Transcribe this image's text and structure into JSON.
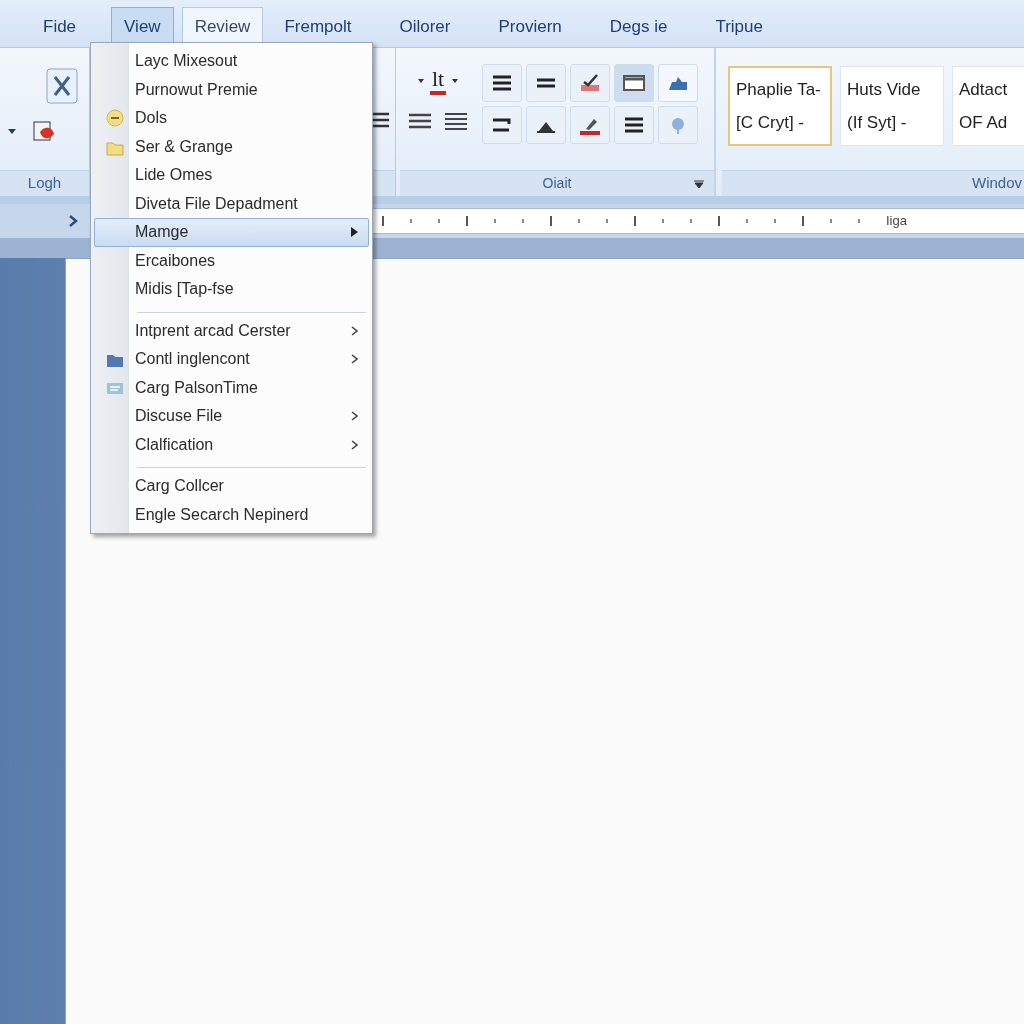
{
  "tabs": [
    {
      "label": "Fide",
      "selected": false,
      "highlighted": false
    },
    {
      "label": "View",
      "selected": true,
      "highlighted": false
    },
    {
      "label": "Review",
      "selected": false,
      "highlighted": true
    },
    {
      "label": "Frempolt",
      "selected": false,
      "highlighted": false
    },
    {
      "label": "Oilorer",
      "selected": false,
      "highlighted": false
    },
    {
      "label": "Proviern",
      "selected": false,
      "highlighted": false
    },
    {
      "label": "Degs ie",
      "selected": false,
      "highlighted": false
    },
    {
      "label": "Tripue",
      "selected": false,
      "highlighted": false
    }
  ],
  "ribbon": {
    "groups": [
      {
        "label": "Logh"
      },
      {
        "label": "Oiait"
      },
      {
        "label": "Windov"
      }
    ],
    "font_color_label": "lt",
    "styles": [
      {
        "name": "Phaplie Ta-",
        "sub": "[C Cryt] -",
        "selected": true
      },
      {
        "name": "Huts Vide",
        "sub": "(If Syt] -",
        "selected": false
      },
      {
        "name": "Adtact",
        "sub": "OF Ad",
        "selected": false
      }
    ]
  },
  "ruler": {
    "label": "Iiga"
  },
  "menu": {
    "items": [
      {
        "kind": "item",
        "label": "Layc Mixesout",
        "submenu": false,
        "selected": false
      },
      {
        "kind": "item",
        "label": "Purnowut Premie",
        "submenu": false,
        "selected": false
      },
      {
        "kind": "item",
        "label": "Dols",
        "submenu": false,
        "selected": false
      },
      {
        "kind": "item",
        "label": "Ser & Grange",
        "submenu": false,
        "selected": false
      },
      {
        "kind": "item",
        "label": "Lide Omes",
        "submenu": false,
        "selected": false
      },
      {
        "kind": "item",
        "label": "Diveta File Depadment",
        "submenu": false,
        "selected": false
      },
      {
        "kind": "item",
        "label": "Mamge",
        "submenu": true,
        "selected": true
      },
      {
        "kind": "item",
        "label": "Ercaibones",
        "submenu": false,
        "selected": false
      },
      {
        "kind": "item",
        "label": "Midis [Tap-fse",
        "submenu": false,
        "selected": false
      },
      {
        "kind": "separator"
      },
      {
        "kind": "item",
        "label": "Intprent arcad Cerster",
        "submenu": true,
        "selected": false
      },
      {
        "kind": "item",
        "label": "Contl inglencont",
        "submenu": true,
        "selected": false
      },
      {
        "kind": "item",
        "label": "Carg PalsonTime",
        "submenu": false,
        "selected": false
      },
      {
        "kind": "item",
        "label": "Discuse File",
        "submenu": true,
        "selected": false
      },
      {
        "kind": "item",
        "label": "Clalfication",
        "submenu": true,
        "selected": false
      },
      {
        "kind": "separator"
      },
      {
        "kind": "item",
        "label": "Carg Collcer",
        "submenu": false,
        "selected": false
      },
      {
        "kind": "item",
        "label": "Engle Secarch Nepinerd",
        "submenu": false,
        "selected": false
      }
    ]
  }
}
